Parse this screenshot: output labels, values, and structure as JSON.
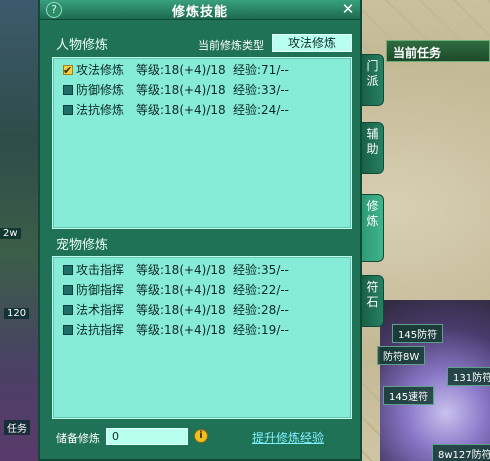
{
  "window": {
    "title": "修炼技能",
    "help_icon": "?",
    "close_icon": "✕"
  },
  "person": {
    "heading": "人物修炼",
    "current_type_label": "当前修炼类型",
    "current_type_value": "攻法修炼",
    "rows": [
      {
        "name": "攻法修炼",
        "level": "等级:18(+4)/18",
        "exp": "经验:71/--",
        "checked": true
      },
      {
        "name": "防御修炼",
        "level": "等级:18(+4)/18",
        "exp": "经验:33/--",
        "checked": false
      },
      {
        "name": "法抗修炼",
        "level": "等级:18(+4)/18",
        "exp": "经验:24/--",
        "checked": false
      }
    ]
  },
  "pet": {
    "heading": "宠物修炼",
    "rows": [
      {
        "name": "攻击指挥",
        "level": "等级:18(+4)/18",
        "exp": "经验:35/--"
      },
      {
        "name": "防御指挥",
        "level": "等级:18(+4)/18",
        "exp": "经验:22/--"
      },
      {
        "name": "法术指挥",
        "level": "等级:18(+4)/18",
        "exp": "经验:28/--"
      },
      {
        "name": "法抗指挥",
        "level": "等级:18(+4)/18",
        "exp": "经验:19/--"
      }
    ]
  },
  "footer": {
    "reserve_label": "储备修炼",
    "reserve_value": "0",
    "info_icon": "i",
    "upgrade_link": "提升修炼经验"
  },
  "tabs": [
    {
      "label": "门派"
    },
    {
      "label": "辅助"
    },
    {
      "label": "修炼"
    },
    {
      "label": "符石"
    }
  ],
  "background": {
    "quest_title": "当前任务",
    "tags": [
      "145防符",
      "防符8W",
      "131防符",
      "145速符",
      "8w127防符"
    ],
    "left_fragments": [
      "2w",
      "120",
      "任务"
    ]
  }
}
